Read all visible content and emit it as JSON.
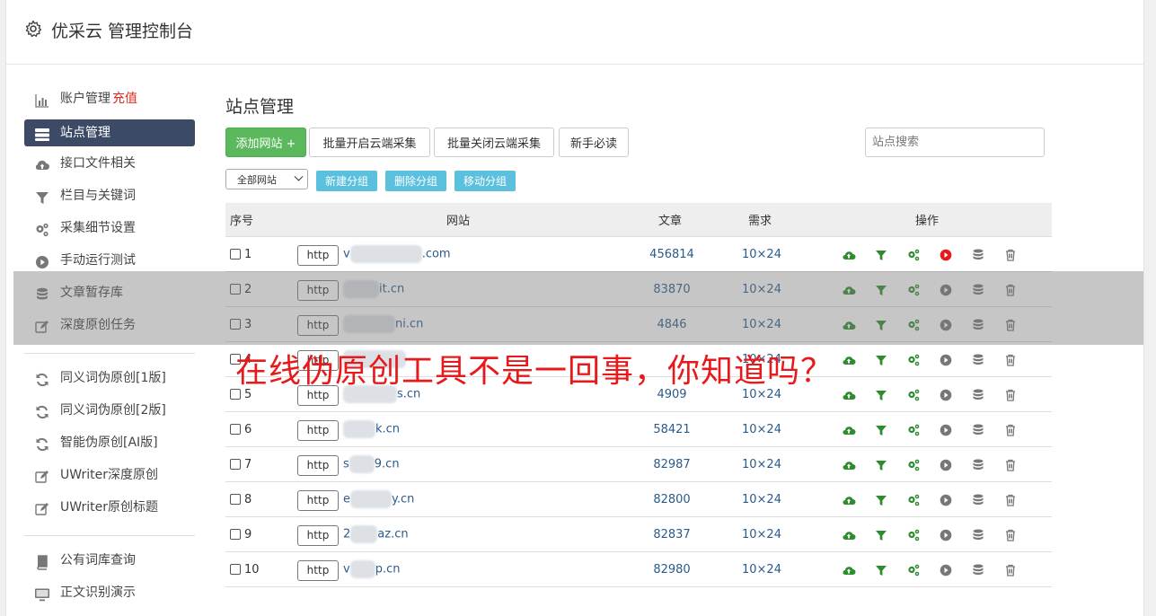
{
  "header": {
    "title": "优采云 管理控制台"
  },
  "sidebar": {
    "items": [
      {
        "label": "账户管理",
        "extra": "充值",
        "icon": "bar-chart-icon"
      },
      {
        "label": "站点管理",
        "icon": "server-icon",
        "active": true
      },
      {
        "label": "接口文件相关",
        "icon": "cloud-upload-icon"
      },
      {
        "label": "栏目与关键词",
        "icon": "filter-icon"
      },
      {
        "label": "采集细节设置",
        "icon": "cogs-icon"
      },
      {
        "label": "手动运行测试",
        "icon": "play-circle-icon"
      },
      {
        "label": "文章暂存库",
        "icon": "database-icon"
      },
      {
        "label": "深度原创任务",
        "icon": "edit-icon"
      }
    ],
    "items2": [
      {
        "label": "同义词伪原创[1版]",
        "icon": "refresh-icon"
      },
      {
        "label": "同义词伪原创[2版]",
        "icon": "refresh-icon"
      },
      {
        "label": "智能伪原创[AI版]",
        "icon": "refresh-icon"
      },
      {
        "label": "UWriter深度原创",
        "icon": "edit-icon"
      },
      {
        "label": "UWriter原创标题",
        "icon": "edit-icon"
      }
    ],
    "items3": [
      {
        "label": "公有词库查询",
        "icon": "book-icon"
      },
      {
        "label": "正文识别演示",
        "icon": "monitor-icon"
      }
    ]
  },
  "main": {
    "title": "站点管理",
    "buttons": {
      "add": "添加网站 +",
      "batch_open": "批量开启云端采集",
      "batch_close": "批量关闭云端采集",
      "newbie": "新手必读"
    },
    "search_placeholder": "站点搜索",
    "group_select": "全部网站",
    "group_buttons": {
      "new": "新建分组",
      "delete": "删除分组",
      "move": "移动分组"
    },
    "table": {
      "headers": {
        "index": "序号",
        "site": "网站",
        "articles": "文章",
        "demand": "需求",
        "ops": "操作"
      },
      "http_label": "http",
      "rows": [
        {
          "index": "1",
          "prefix": "v",
          "suffix": ".com",
          "articles": "456814",
          "demand": "10×24",
          "running": true
        },
        {
          "index": "2",
          "prefix": "",
          "suffix": "it.cn",
          "articles": "83870",
          "demand": "10×24",
          "running": false
        },
        {
          "index": "3",
          "prefix": "",
          "suffix": "ni.cn",
          "articles": "4846",
          "demand": "10×24",
          "running": false
        },
        {
          "index": "4",
          "prefix": "",
          "suffix": "",
          "articles": "",
          "demand": "10×24",
          "running": false
        },
        {
          "index": "5",
          "prefix": "",
          "suffix": "s.cn",
          "articles": "4909",
          "demand": "10×24",
          "running": false
        },
        {
          "index": "6",
          "prefix": "",
          "suffix": "k.cn",
          "articles": "58421",
          "demand": "10×24",
          "running": false
        },
        {
          "index": "7",
          "prefix": "s",
          "suffix": "9.cn",
          "articles": "82987",
          "demand": "10×24",
          "running": false
        },
        {
          "index": "8",
          "prefix": "e",
          "suffix": "y.cn",
          "articles": "82800",
          "demand": "10×24",
          "running": false
        },
        {
          "index": "9",
          "prefix": "2",
          "suffix": "az.cn",
          "articles": "82837",
          "demand": "10×24",
          "running": false
        },
        {
          "index": "10",
          "prefix": "v",
          "suffix": "p.cn",
          "articles": "82980",
          "demand": "10×24",
          "running": false
        }
      ]
    }
  },
  "overlay_caption": "在线伪原创工具不是一回事，你知道吗？",
  "colors": {
    "accent": "#3c4a66",
    "green": "#5cb85c",
    "info": "#5bc0de",
    "link": "#2a5a8c",
    "red": "#e8191b",
    "icon_green": "#2e8b2e"
  }
}
